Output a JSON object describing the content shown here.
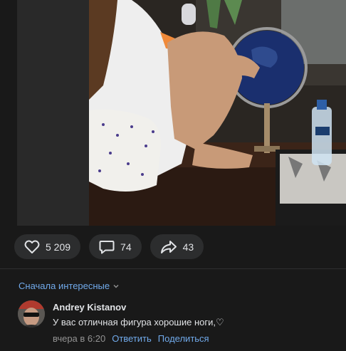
{
  "actions": {
    "likes": "5 209",
    "comments": "74",
    "shares": "43"
  },
  "comments_sort": {
    "label": "Сначала интересные"
  },
  "comment": {
    "author": "Andrey Kistanov",
    "text": "У вас отличная фигура хорошие ноги,♡",
    "time": "вчера в 6:20",
    "reply_label": "Ответить",
    "share_label": "Поделиться"
  },
  "colors": {
    "background": "#191919",
    "button_bg": "#2c2d2e",
    "link": "#71aaeb",
    "muted": "#939393",
    "text": "#e1e3e6"
  },
  "icons": {
    "like": "heart-icon",
    "comment": "comment-bubble-icon",
    "share": "share-arrow-icon",
    "sort": "chevron-down-icon"
  }
}
